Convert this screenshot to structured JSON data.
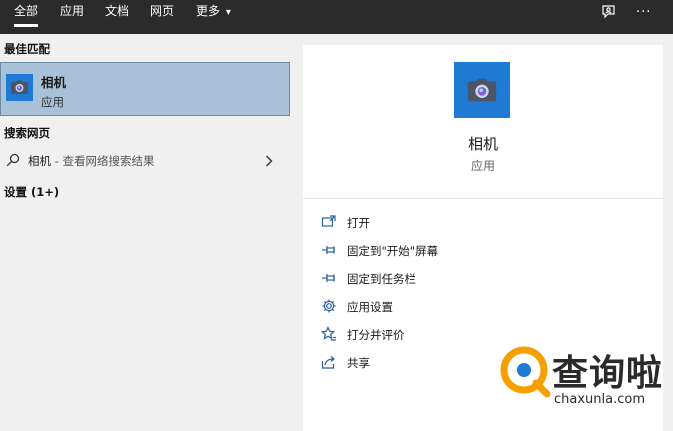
{
  "tabs": [
    {
      "label": "全部",
      "active": true
    },
    {
      "label": "应用",
      "active": false
    },
    {
      "label": "文档",
      "active": false
    },
    {
      "label": "网页",
      "active": false
    },
    {
      "label": "更多",
      "active": false
    }
  ],
  "topbar_icons": [
    "feedback-icon",
    "more-options-icon"
  ],
  "more_glyph": "▾",
  "ellipsis": "···",
  "left": {
    "best_match_title": "最佳匹配",
    "best_match": {
      "name": "相机",
      "type": "应用"
    },
    "web_title": "搜索网页",
    "web_query": "相机",
    "web_suffix": " - 查看网络搜索结果",
    "settings_title": "设置 (1+)"
  },
  "right": {
    "app_name": "相机",
    "app_type": "应用",
    "actions": [
      {
        "label": "打开",
        "icon": "open-icon"
      },
      {
        "label": "固定到\"开始\"屏幕",
        "icon": "pin-start-icon"
      },
      {
        "label": "固定到任务栏",
        "icon": "pin-taskbar-icon"
      },
      {
        "label": "应用设置",
        "icon": "gear-icon"
      },
      {
        "label": "打分并评价",
        "icon": "rate-icon"
      },
      {
        "label": "共享",
        "icon": "share-icon"
      }
    ]
  },
  "watermark": {
    "title": "查询啦",
    "url": "chaxunla.com"
  },
  "colors": {
    "accent": "#1e7ad2",
    "selected_bg": "#a9c1d8",
    "topbar_bg": "#2b2b2b",
    "watermark_orange": "#f5a000"
  }
}
